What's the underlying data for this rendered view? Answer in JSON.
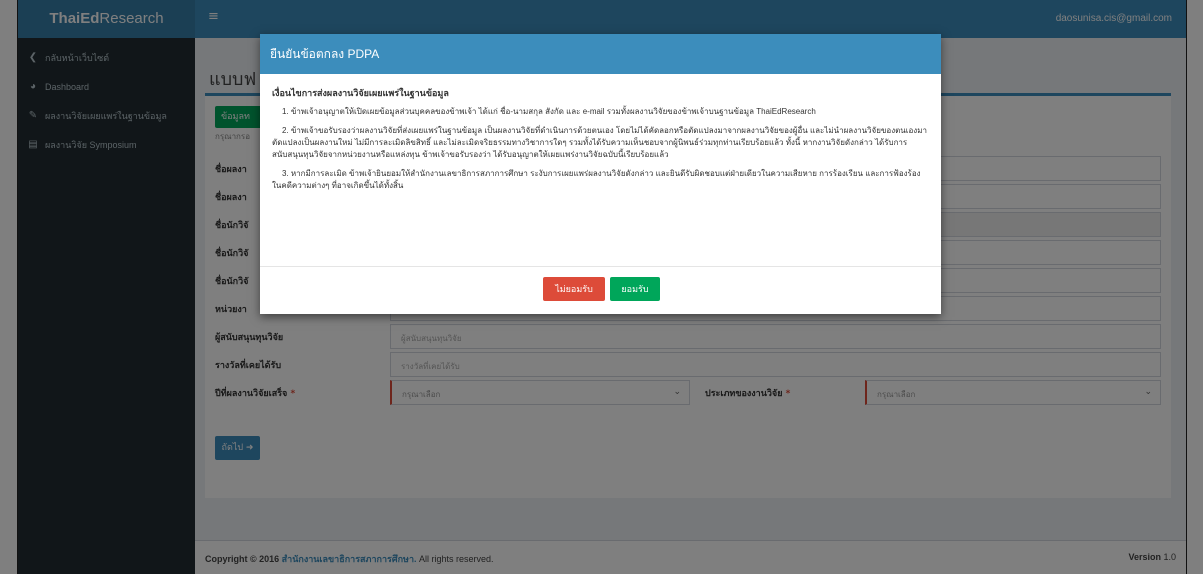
{
  "header": {
    "logo_prefix": "ThaiEd",
    "logo_suffix": "Research",
    "user_email": "daosunisa.cis@gmail.com"
  },
  "sidebar": {
    "items": [
      {
        "label": "กลับหน้าเว็บไซต์",
        "icon": "chevron-left-icon"
      },
      {
        "label": "Dashboard",
        "icon": "dashboard-icon"
      },
      {
        "label": "ผลงานวิจัยเผยแพร่ในฐานข้อมูล",
        "icon": "tag-icon"
      },
      {
        "label": "ผลงานวิจัย Symposium",
        "icon": "file-icon"
      }
    ]
  },
  "main": {
    "title": "แบบฟ",
    "tab_label": "ข้อมูลท",
    "hint": "กรุณากรอ",
    "fields": [
      {
        "label": "ชื่อผลงา",
        "placeholder": ""
      },
      {
        "label": "ชื่อผลงา",
        "placeholder": ""
      },
      {
        "label": "ชื่อนักวิจั",
        "placeholder": ""
      },
      {
        "label": "ชื่อนักวิจั",
        "placeholder": ""
      },
      {
        "label": "ชื่อนักวิจั",
        "placeholder": ""
      },
      {
        "label": "หน่วยงา",
        "placeholder": "หน่วยงาน"
      },
      {
        "label": "ผู้สนับสนุนทุนวิจัย",
        "placeholder": "ผู้สนับสนุนทุนวิจัย"
      },
      {
        "label": "รางวัลที่เคยได้รับ",
        "placeholder": "รางวัลที่เคยได้รับ"
      }
    ],
    "year_label": "ปีที่ผลงานวิจัยเสร็จ",
    "year_select": "กรุณาเลือก",
    "type_label": "ประเภทของงานวิจัย",
    "type_select": "กรุณาเลือก",
    "required_mark": "*",
    "next_button": "ถัดไป ➜"
  },
  "footer": {
    "copyright_prefix": "Copyright © 2016",
    "org": "สำนักงานเลขาธิการสภาการศึกษา.",
    "rights": "All rights reserved.",
    "version_label": "Version",
    "version_number": "1.0"
  },
  "modal": {
    "title": "ยืนยันข้อตกลง PDPA",
    "heading": "เงื่อนไขการส่งผลงานวิจัยเผยแพร่ในฐานข้อมูล",
    "para1": "1. ข้าพเจ้าอนุญาตให้เปิดเผยข้อมูลส่วนบุคคลของข้าพเจ้า ได้แก่ ชื่อ-นามสกุล สังกัด และ e-mail รวมทั้งผลงานวิจัยของข้าพเจ้าบนฐานข้อมูล ThaiEdResearch",
    "para2": "2. ข้าพเจ้าขอรับรองว่าผลงานวิจัยที่ส่งเผยแพร่ในฐานข้อมูล เป็นผลงานวิจัยที่ดำเนินการด้วยตนเอง โดยไม่ได้คัดลอกหรือตัดแปลงมาจากผลงานวิจัยของผู้อื่น และไม่นำผลงานวิจัยของตนเองมาตัดแปลงเป็นผลงานใหม่ ไม่มีการละเมิดลิขสิทธิ์ และไม่ละเมิดจริยธรรมทางวิชาการใดๆ รวมทั้งได้รับความเห็นชอบจากผู้นิพนธ์ร่วมทุกท่านเรียบร้อยแล้ว ทั้งนี้ หากงานวิจัยดังกล่าว ได้รับการสนับสนุนทุนวิจัยจากหน่วยงานหรือแหล่งทุน ข้าพเจ้าขอรับรองว่า ได้รับอนุญาตให้เผยแพร่งานวิจัยฉบับนี้เรียบร้อยแล้ว",
    "para3": "3. หากมีการละเมิด ข้าพเจ้ายินยอมให้สำนักงานเลขาธิการสภาการศึกษา ระงับการเผยแพร่ผลงานวิจัยดังกล่าว และยินดีรับผิดชอบแต่ฝ่ายเดียวในความเสียหาย การร้องเรียน และการฟ้องร้องในคดีความต่างๆ ที่อาจเกิดขึ้นได้ทั้งสิ้น",
    "disagree_button": "ไม่ยอมรับ",
    "agree_button": "ยอมรับ"
  }
}
